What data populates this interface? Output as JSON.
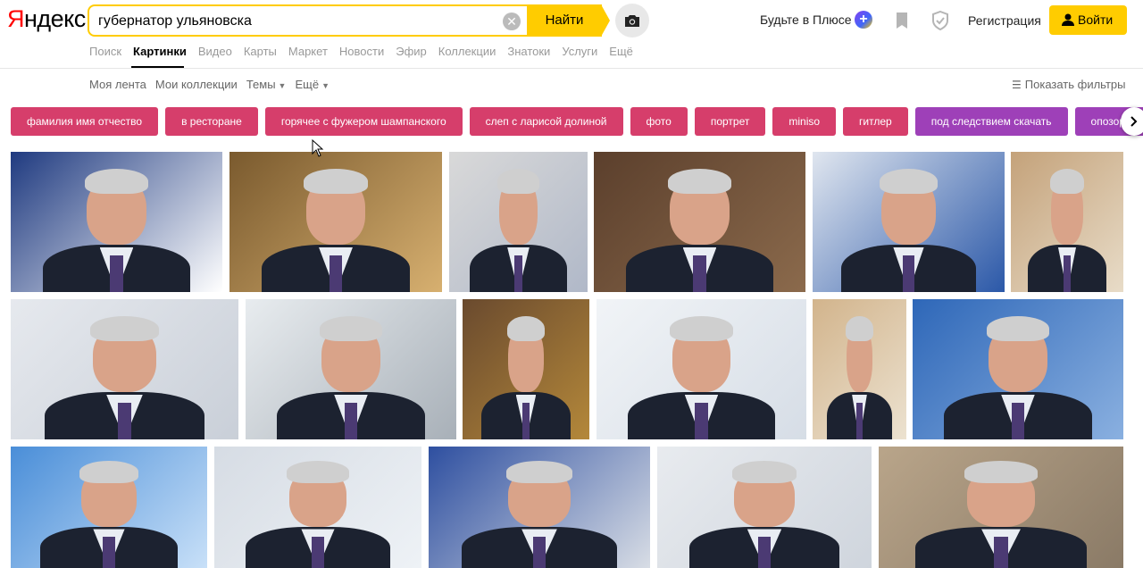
{
  "logo": {
    "first": "Я",
    "rest": "ндекс"
  },
  "search": {
    "query": "губернатор ульяновска",
    "button": "Найти"
  },
  "header": {
    "plus": "Будьте в Плюсе",
    "plus_badge": "+",
    "register": "Регистрация",
    "login": "Войти"
  },
  "services": [
    "Поиск",
    "Картинки",
    "Видео",
    "Карты",
    "Маркет",
    "Новости",
    "Эфир",
    "Коллекции",
    "Знатоки",
    "Услуги",
    "Ещё"
  ],
  "subnav": {
    "feed": "Моя лента",
    "collections": "Мои коллекции",
    "themes": "Темы",
    "more": "Ещё",
    "filters": "Показать фильтры"
  },
  "chips": [
    {
      "label": "фамилия имя отчество",
      "color": "#d63e6b"
    },
    {
      "label": "в ресторане",
      "color": "#d63e6b"
    },
    {
      "label": "горячее с фужером шампанского",
      "color": "#d63e6b"
    },
    {
      "label": "слеп с ларисой долиной",
      "color": "#d63e6b"
    },
    {
      "label": "фото",
      "color": "#d63e6b"
    },
    {
      "label": "портрет",
      "color": "#d63e6b"
    },
    {
      "label": "miniso",
      "color": "#d63e6b"
    },
    {
      "label": "гитлер",
      "color": "#d63e6b"
    },
    {
      "label": "под следствием скачать",
      "color": "#9e40b8"
    },
    {
      "label": "опозорился",
      "color": "#9e40b8"
    }
  ],
  "colors": {
    "accent": "#ffcc00",
    "chip_pink": "#d63e6b",
    "chip_purple": "#9e40b8"
  }
}
